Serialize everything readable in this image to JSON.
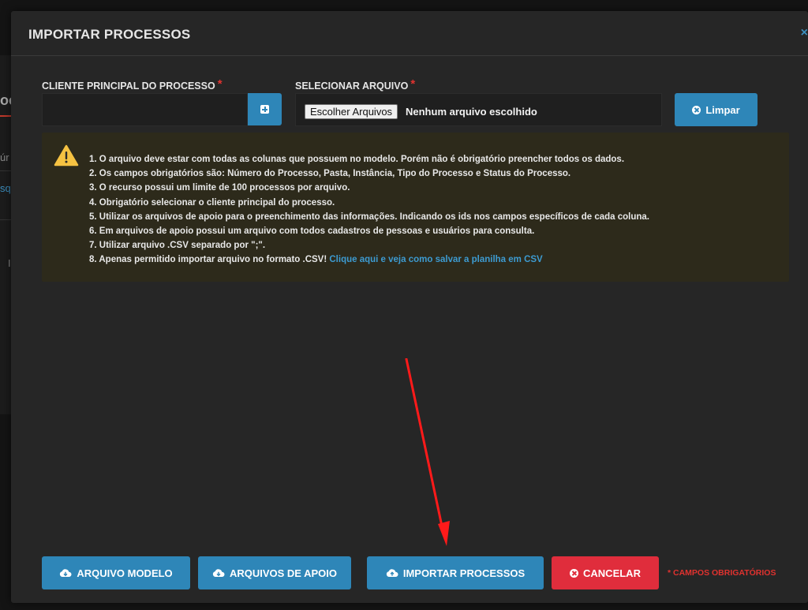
{
  "background": {
    "fragment_1": "oc",
    "fragment_2": "úr",
    "fragment_3": "sq",
    "fragment_4": "I"
  },
  "modal": {
    "title": "IMPORTAR PROCESSOS",
    "close_glyph": "×"
  },
  "form": {
    "client_label": "CLIENTE PRINCIPAL DO PROCESSO",
    "file_label": "SELECIONAR ARQUIVO",
    "required_marker": "*",
    "choose_files_label": "Escolher Arquivos",
    "file_status": "Nenhum arquivo escolhido",
    "clear_label": "Limpar"
  },
  "alert": {
    "items": [
      "1. O arquivo deve estar com todas as colunas que possuem no modelo. Porém não é obrigatório preencher todos os dados.",
      "2. Os campos obrigatórios são: Número do Processo, Pasta, Instância, Tipo do Processo e Status do Processo.",
      "3. O recurso possui um limite de 100 processos por arquivo.",
      "4. Obrigatório selecionar o cliente principal do processo.",
      "5. Utilizar os arquivos de apoio para o preenchimento das informações. Indicando os ids nos campos específicos de cada coluna.",
      "6. Em arquivos de apoio possui um arquivo com todos cadastros de pessoas e usuários para consulta.",
      "7. Utilizar arquivo .CSV separado por \";\".",
      "8. Apenas permitido importar arquivo no formato .CSV!"
    ],
    "csv_link": "Clique aqui e veja como salvar a planilha em CSV"
  },
  "footer": {
    "model_label": "ARQUIVO MODELO",
    "support_label": "ARQUIVOS DE APOIO",
    "import_label": "IMPORTAR PROCESSOS",
    "cancel_label": "CANCELAR",
    "required_note": "* CAMPOS OBRIGATÓRIOS"
  },
  "colors": {
    "primary": "#2e86b8",
    "danger": "#e02d3c",
    "warning_bg": "#2d2a1b",
    "link": "#3d9bd1",
    "annotation_arrow": "#ff1a1a"
  }
}
